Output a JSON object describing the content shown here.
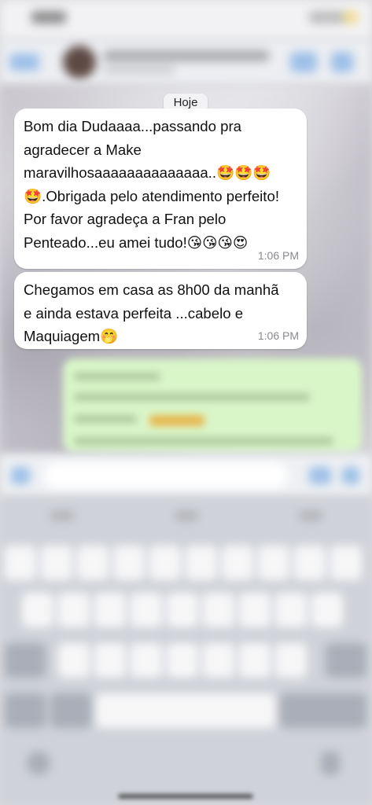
{
  "chat": {
    "date_label": "Hoje",
    "messages": [
      {
        "lines": [
          "Bom dia Dudaaaa...passando pra",
          "agradecer a Make",
          "maravilhosaaaaaaaaaaaaaa..🤩🤩🤩",
          "🤩.Obrigada pelo atendimento perfeito!",
          "Por favor agradeça a Fran pelo",
          "Penteado...eu amei tudo!😘😘😘😍"
        ],
        "time": "1:06 PM"
      },
      {
        "lines": [
          "Chegamos em casa as 8h00 da manhã",
          "e ainda estava perfeita ...cabelo e",
          "Maquiagem🤭"
        ],
        "time": "1:06 PM"
      }
    ]
  },
  "colors": {
    "incoming_bubble": "#ffffff",
    "outgoing_bubble": "#d9f6c9",
    "accent": "#9ec0e8"
  },
  "icons": [
    "back-arrow-icon",
    "avatar",
    "video-call-icon",
    "phone-icon",
    "plus-icon",
    "camera-icon",
    "microphone-icon"
  ]
}
